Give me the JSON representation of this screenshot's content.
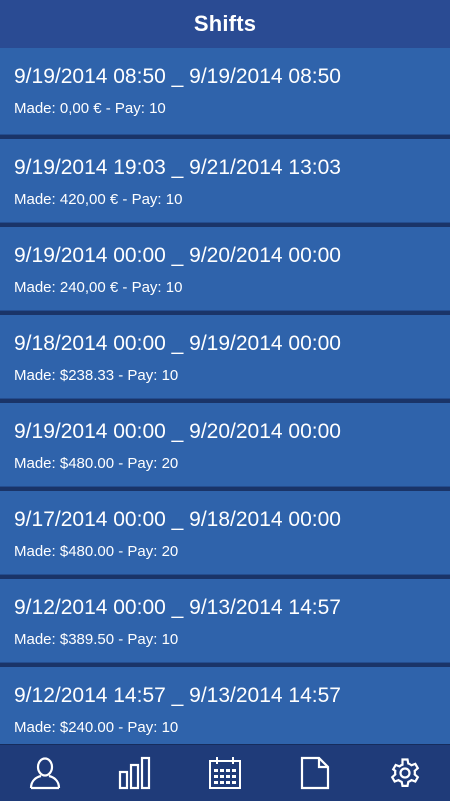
{
  "header": {
    "title": "Shifts"
  },
  "shifts": [
    {
      "range": "9/19/2014 08:50 _ 9/19/2014 08:50",
      "detail": "Made: 0,00 € - Pay: 10"
    },
    {
      "range": "9/19/2014 19:03 _ 9/21/2014 13:03",
      "detail": "Made: 420,00 € - Pay: 10"
    },
    {
      "range": "9/19/2014 00:00 _ 9/20/2014 00:00",
      "detail": "Made: 240,00 € - Pay: 10"
    },
    {
      "range": "9/18/2014 00:00 _ 9/19/2014 00:00",
      "detail": "Made: $238.33 - Pay: 10"
    },
    {
      "range": "9/19/2014 00:00 _ 9/20/2014 00:00",
      "detail": "Made: $480.00 - Pay: 20"
    },
    {
      "range": "9/17/2014 00:00 _ 9/18/2014 00:00",
      "detail": "Made: $480.00 - Pay: 20"
    },
    {
      "range": "9/12/2014 00:00 _ 9/13/2014 14:57",
      "detail": "Made: $389.50 - Pay: 10"
    },
    {
      "range": "9/12/2014 14:57 _ 9/13/2014 14:57",
      "detail": "Made: $240.00 - Pay: 10"
    }
  ],
  "tabbar": {
    "items": [
      {
        "icon": "user-icon"
      },
      {
        "icon": "bar-chart-icon"
      },
      {
        "icon": "calendar-icon"
      },
      {
        "icon": "document-icon"
      },
      {
        "icon": "gear-icon"
      }
    ]
  },
  "colors": {
    "header": "#2a4b93",
    "row": "#2f63ab",
    "row_gap": "#1a3468",
    "tabbar": "#1f3b79",
    "text": "#ffffff"
  }
}
